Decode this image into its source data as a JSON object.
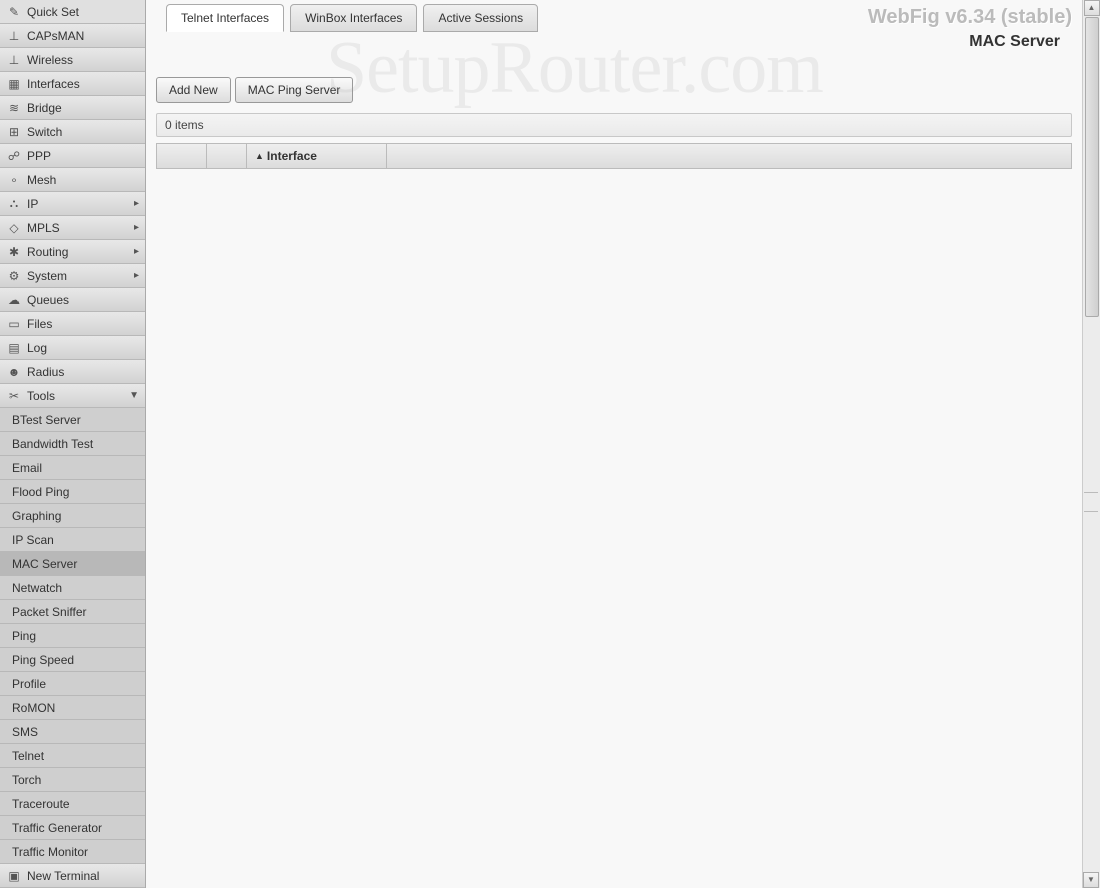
{
  "app": {
    "version": "WebFig v6.34 (stable)",
    "page_title": "MAC Server",
    "watermark": "SetupRouter.com"
  },
  "sidebar": {
    "items": [
      {
        "label": "Quick Set",
        "icon": "✎",
        "submenu": false
      },
      {
        "label": "CAPsMAN",
        "icon": "⊥",
        "submenu": false
      },
      {
        "label": "Wireless",
        "icon": "⊥",
        "submenu": false
      },
      {
        "label": "Interfaces",
        "icon": "▦",
        "submenu": false
      },
      {
        "label": "Bridge",
        "icon": "≋",
        "submenu": false
      },
      {
        "label": "Switch",
        "icon": "⊞",
        "submenu": false
      },
      {
        "label": "PPP",
        "icon": "☍",
        "submenu": false
      },
      {
        "label": "Mesh",
        "icon": "∘",
        "submenu": false
      },
      {
        "label": "IP",
        "icon": "⛬",
        "submenu": true
      },
      {
        "label": "MPLS",
        "icon": "◇",
        "submenu": true
      },
      {
        "label": "Routing",
        "icon": "✱",
        "submenu": true
      },
      {
        "label": "System",
        "icon": "⚙",
        "submenu": true
      },
      {
        "label": "Queues",
        "icon": "☁",
        "submenu": false
      },
      {
        "label": "Files",
        "icon": "▭",
        "submenu": false
      },
      {
        "label": "Log",
        "icon": "▤",
        "submenu": false
      },
      {
        "label": "Radius",
        "icon": "☻",
        "submenu": false
      },
      {
        "label": "Tools",
        "icon": "✂",
        "submenu": true,
        "expanded": true
      }
    ],
    "tools_submenu": [
      {
        "label": "BTest Server"
      },
      {
        "label": "Bandwidth Test"
      },
      {
        "label": "Email"
      },
      {
        "label": "Flood Ping"
      },
      {
        "label": "Graphing"
      },
      {
        "label": "IP Scan"
      },
      {
        "label": "MAC Server",
        "active": true
      },
      {
        "label": "Netwatch"
      },
      {
        "label": "Packet Sniffer"
      },
      {
        "label": "Ping"
      },
      {
        "label": "Ping Speed"
      },
      {
        "label": "Profile"
      },
      {
        "label": "RoMON"
      },
      {
        "label": "SMS"
      },
      {
        "label": "Telnet"
      },
      {
        "label": "Torch"
      },
      {
        "label": "Traceroute"
      },
      {
        "label": "Traffic Generator"
      },
      {
        "label": "Traffic Monitor"
      }
    ],
    "after_tools": [
      {
        "label": "New Terminal",
        "icon": "▣"
      }
    ]
  },
  "tabs": [
    {
      "label": "Telnet Interfaces",
      "active": true
    },
    {
      "label": "WinBox Interfaces"
    },
    {
      "label": "Active Sessions"
    }
  ],
  "toolbar": {
    "add_new": "Add New",
    "mac_ping": "MAC Ping Server"
  },
  "status": {
    "count_text": "0 items"
  },
  "table": {
    "columns": {
      "interface": "Interface"
    },
    "sort_indicator": "▲"
  }
}
